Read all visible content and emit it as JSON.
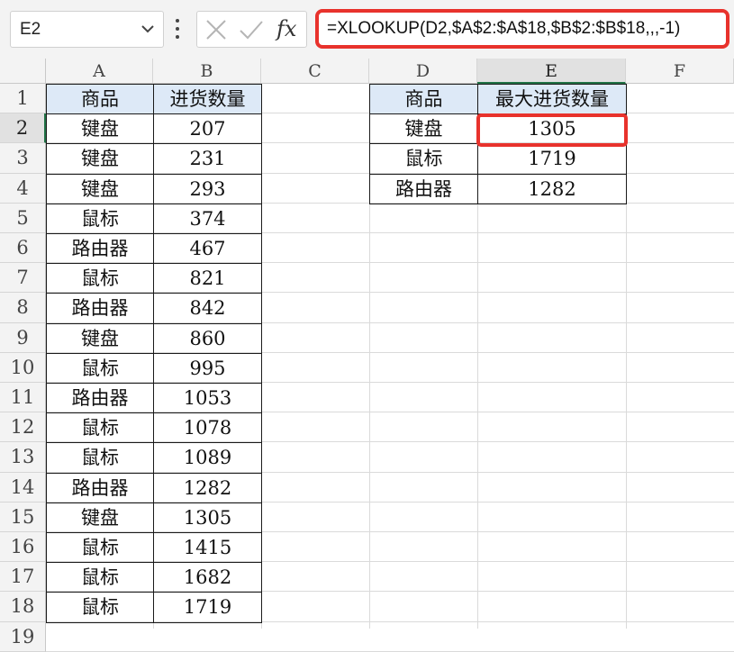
{
  "formula_bar": {
    "name_box": "E2",
    "name_box_icon": "chevron-down-icon",
    "menu_icon": "more-vertical-icon",
    "cancel_icon": "cross-icon",
    "confirm_icon": "check-icon",
    "fx_label": "fx",
    "formula": "=XLOOKUP(D2,$A$2:$A$18,$B$2:$B$18,,,-1)",
    "highlight_color": "#e8322c"
  },
  "columns": [
    "A",
    "B",
    "C",
    "D",
    "E",
    "F"
  ],
  "rows": [
    "1",
    "2",
    "3",
    "4",
    "5",
    "6",
    "7",
    "8",
    "9",
    "10",
    "11",
    "12",
    "13",
    "14",
    "15",
    "16",
    "17",
    "18",
    "19"
  ],
  "selected_cell": "E2",
  "accent_color": "#217346",
  "header_fill": "#dde9f7",
  "table1": {
    "headers": [
      "商品",
      "进货数量"
    ],
    "rows": [
      [
        "键盘",
        "207"
      ],
      [
        "键盘",
        "231"
      ],
      [
        "键盘",
        "293"
      ],
      [
        "鼠标",
        "374"
      ],
      [
        "路由器",
        "467"
      ],
      [
        "鼠标",
        "821"
      ],
      [
        "路由器",
        "842"
      ],
      [
        "键盘",
        "860"
      ],
      [
        "鼠标",
        "995"
      ],
      [
        "路由器",
        "1053"
      ],
      [
        "鼠标",
        "1078"
      ],
      [
        "鼠标",
        "1089"
      ],
      [
        "路由器",
        "1282"
      ],
      [
        "键盘",
        "1305"
      ],
      [
        "鼠标",
        "1415"
      ],
      [
        "鼠标",
        "1682"
      ],
      [
        "鼠标",
        "1719"
      ]
    ]
  },
  "table2": {
    "headers": [
      "商品",
      "最大进货数量"
    ],
    "rows": [
      [
        "键盘",
        "1305"
      ],
      [
        "鼠标",
        "1719"
      ],
      [
        "路由器",
        "1282"
      ]
    ]
  }
}
